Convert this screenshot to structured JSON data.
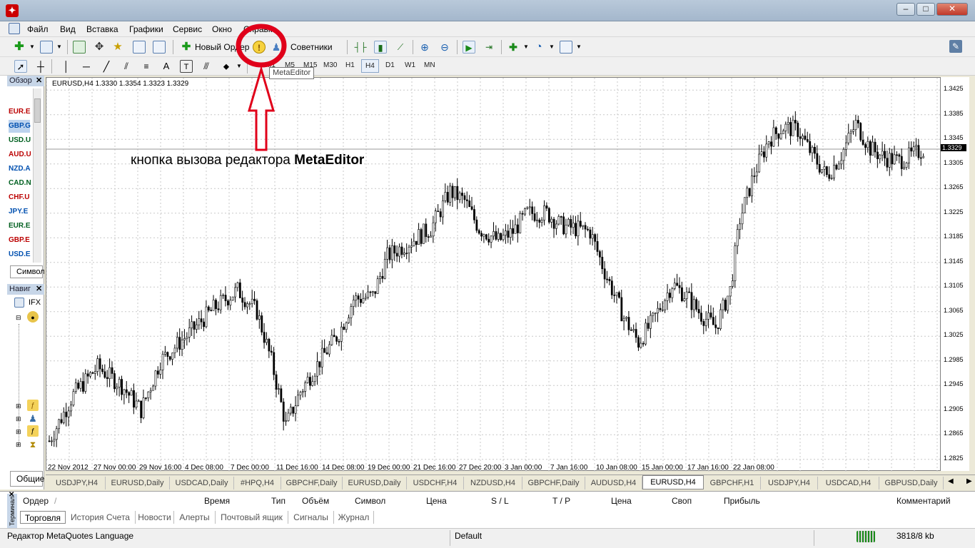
{
  "menu": {
    "items": [
      "Файл",
      "Вид",
      "Вставка",
      "Графики",
      "Сервис",
      "Окно",
      "Справка"
    ]
  },
  "toolbar": {
    "new_order": "Новый Ордер",
    "advisors": "Советники",
    "tooltip": "MetaEditor"
  },
  "timeframes": [
    "M1",
    "M5",
    "M15",
    "M30",
    "H1",
    "H4",
    "D1",
    "W1",
    "MN"
  ],
  "timeframe_active": "H4",
  "left_panel": {
    "market_watch_title": "Обзор",
    "market_watch_tab": "Символ",
    "symbols": [
      "EUR.E",
      "GBP.G",
      "USD.U",
      "AUD.U",
      "NZD.A",
      "CAD.N",
      "CHF.U",
      "JPY.E",
      "EUR.E",
      "GBP.E",
      "USD.E"
    ],
    "navigator_title": "Навиг",
    "navigator_root": "IFX",
    "bottom_tab": "Общие"
  },
  "chart": {
    "header": "EURUSD,H4  1.3330 1.3354 1.3323 1.3329",
    "current_price": "1.3329",
    "annotation_text": "кнопка вызова редактора ",
    "annotation_bold": "MetaEditor",
    "price_labels": [
      "1.3425",
      "1.3385",
      "1.3345",
      "1.3305",
      "1.3265",
      "1.3225",
      "1.3185",
      "1.3145",
      "1.3105",
      "1.3065",
      "1.3025",
      "1.2985",
      "1.2945",
      "1.2905",
      "1.2865",
      "1.2825"
    ],
    "time_labels": [
      "22 Nov 2012",
      "27 Nov 00:00",
      "29 Nov 16:00",
      "4 Dec 08:00",
      "7 Dec 00:00",
      "11 Dec 16:00",
      "14 Dec 08:00",
      "19 Dec 00:00",
      "21 Dec 16:00",
      "27 Dec 20:00",
      "3 Jan 00:00",
      "7 Jan 16:00",
      "10 Jan 08:00",
      "15 Jan 00:00",
      "17 Jan 16:00",
      "22 Jan 08:00"
    ]
  },
  "chart_tabs": [
    "USDJPY,H4",
    "EURUSD,Daily",
    "USDCAD,Daily",
    "#HPQ,H4",
    "GBPCHF,Daily",
    "EURUSD,Daily",
    "USDCHF,H4",
    "NZDUSD,H4",
    "GBPCHF,Daily",
    "AUDUSD,H4",
    "EURUSD,H4",
    "GBPCHF,H1",
    "USDJPY,H4",
    "USDCAD,H4",
    "GBPUSD,Daily"
  ],
  "chart_tab_active": "EURUSD,H4",
  "terminal": {
    "side_label": "Терминал",
    "columns": [
      "Ордер",
      "/",
      "Время",
      "Тип",
      "Объём",
      "Символ",
      "Цена",
      "S / L",
      "T / P",
      "Цена",
      "Своп",
      "Прибыль",
      "Комментарий"
    ],
    "tabs": [
      "Торговля",
      "История Счета",
      "Новости",
      "Алерты",
      "Почтовый ящик",
      "Сигналы",
      "Журнал"
    ]
  },
  "status": {
    "left": "Редактор MetaQuotes Language",
    "profile": "Default",
    "traffic": "3818/8 kb"
  },
  "colors": {
    "annotation_red": "#e0001a"
  }
}
